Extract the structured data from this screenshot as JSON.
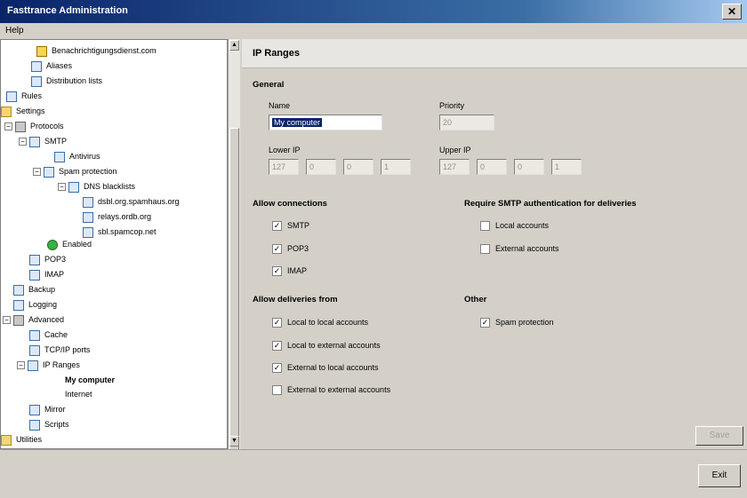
{
  "window": {
    "title": "Fasttrance Administration"
  },
  "menu": {
    "help_label": "Help"
  },
  "tree": {
    "items": [
      {
        "label": "Benachrichtigungsdienst.com",
        "icon": "warning-icon"
      },
      {
        "label": "Aliases",
        "icon": "page-icon"
      },
      {
        "label": "Distribution lists",
        "icon": "page-icon"
      },
      {
        "label": "Rules",
        "icon": "page-icon"
      },
      {
        "label": "Settings",
        "icon": "folder-icon"
      },
      {
        "label": "Protocols",
        "icon": "gear-icon"
      },
      {
        "label": "SMTP",
        "icon": "page-icon"
      },
      {
        "label": "Antivirus",
        "icon": "page-icon"
      },
      {
        "label": "Spam protection",
        "icon": "page-icon"
      },
      {
        "label": "DNS blacklists",
        "icon": "page-icon"
      },
      {
        "label": "dsbl.org.spamhaus.org",
        "icon": "page-icon"
      },
      {
        "label": "relays.ordb.org",
        "icon": "page-icon"
      },
      {
        "label": "sbl.spamcop.net",
        "icon": "page-icon"
      },
      {
        "label": "Enabled",
        "icon": "green-check-icon"
      },
      {
        "label": "POP3",
        "icon": "page-icon"
      },
      {
        "label": "IMAP",
        "icon": "page-icon"
      },
      {
        "label": "Backup",
        "icon": "page-icon"
      },
      {
        "label": "Logging",
        "icon": "page-icon"
      },
      {
        "label": "Advanced",
        "icon": "gear-icon"
      },
      {
        "label": "Cache",
        "icon": "page-icon"
      },
      {
        "label": "TCP/IP ports",
        "icon": "page-icon"
      },
      {
        "label": "IP Ranges",
        "icon": "page-icon"
      },
      {
        "label": "My computer",
        "icon": "none"
      },
      {
        "label": "Internet",
        "icon": "none"
      },
      {
        "label": "Mirror",
        "icon": "page-icon"
      },
      {
        "label": "Scripts",
        "icon": "page-icon"
      },
      {
        "label": "Utilities",
        "icon": "folder-icon"
      }
    ]
  },
  "panel": {
    "title": "IP Ranges",
    "general_heading": "General",
    "name_label": "Name",
    "name_value": "My computer",
    "priority_label": "Priority",
    "priority_value": "20",
    "lower_ip_label": "Lower IP",
    "lower_ip": [
      "127",
      "0",
      "0",
      "1"
    ],
    "upper_ip_label": "Upper IP",
    "upper_ip": [
      "127",
      "0",
      "0",
      "1"
    ],
    "allow_connections_heading": "Allow connections",
    "allow_connections": [
      {
        "label": "SMTP",
        "checked": true
      },
      {
        "label": "POP3",
        "checked": true
      },
      {
        "label": "IMAP",
        "checked": true
      }
    ],
    "require_smtp_auth_heading": "Require SMTP authentication for deliveries",
    "require_smtp_auth": [
      {
        "label": "Local accounts",
        "checked": false
      },
      {
        "label": "External accounts",
        "checked": false
      }
    ],
    "allow_deliveries_heading": "Allow deliveries from",
    "allow_deliveries": [
      {
        "label": "Local to local accounts",
        "checked": true
      },
      {
        "label": "Local to external accounts",
        "checked": true
      },
      {
        "label": "External to local accounts",
        "checked": true
      },
      {
        "label": "External to external accounts",
        "checked": false
      }
    ],
    "other_heading": "Other",
    "other": [
      {
        "label": "Spam protection",
        "checked": true
      }
    ],
    "save_label": "Save"
  },
  "footer": {
    "exit_label": "Exit"
  }
}
